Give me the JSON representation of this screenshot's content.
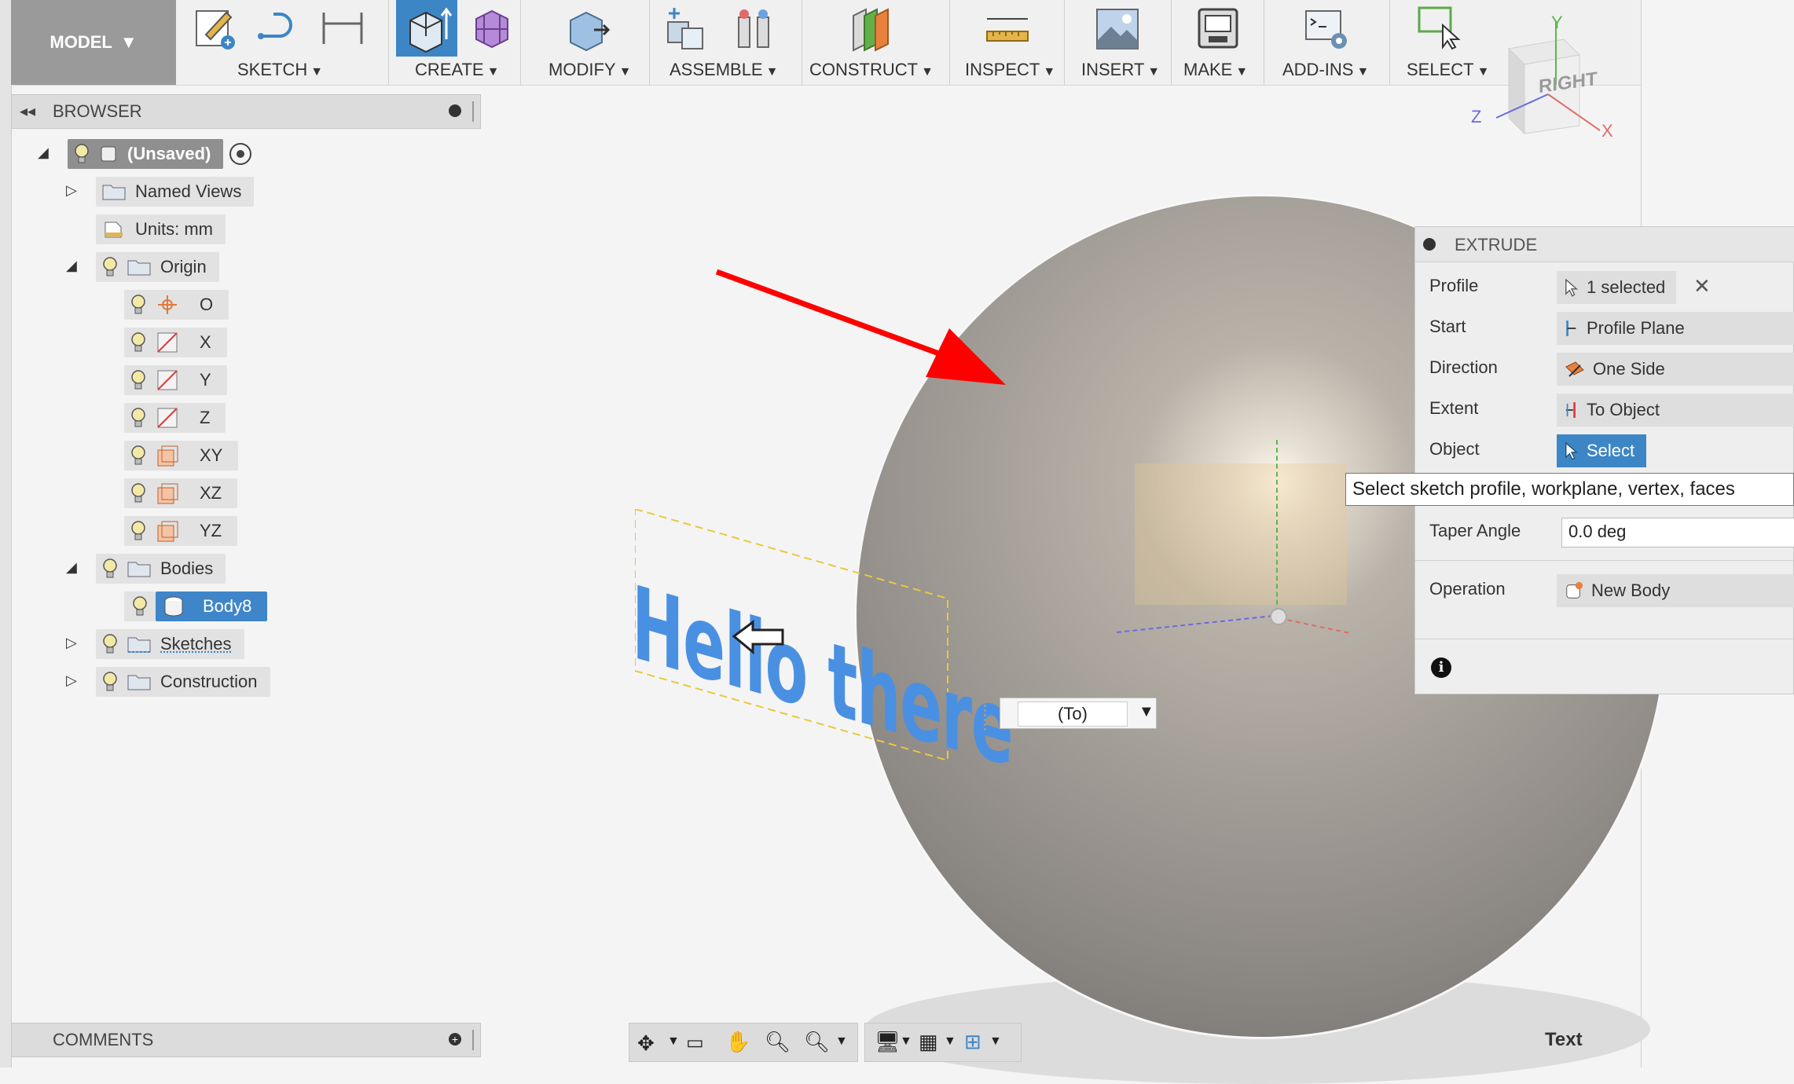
{
  "toolbar": {
    "workspace_label": "MODEL",
    "groups": [
      {
        "label": "SKETCH"
      },
      {
        "label": "CREATE"
      },
      {
        "label": "MODIFY"
      },
      {
        "label": "ASSEMBLE"
      },
      {
        "label": "CONSTRUCT"
      },
      {
        "label": "INSPECT"
      },
      {
        "label": "INSERT"
      },
      {
        "label": "MAKE"
      },
      {
        "label": "ADD-INS"
      },
      {
        "label": "SELECT"
      }
    ]
  },
  "view_cube": {
    "face_label": "RIGHT",
    "axis_y": "Y",
    "axis_z": "Z",
    "axis_x": "X"
  },
  "browser": {
    "title": "BROWSER",
    "tree": {
      "root": "(Unsaved)",
      "named_views": "Named Views",
      "units": "Units: mm",
      "origin": "Origin",
      "origin_items": [
        "O",
        "X",
        "Y",
        "Z",
        "XY",
        "XZ",
        "YZ"
      ],
      "bodies": "Bodies",
      "body_item": "Body8",
      "sketches": "Sketches",
      "construction": "Construction"
    }
  },
  "comments": {
    "title": "COMMENTS"
  },
  "canvas": {
    "sketch_text": "Hello there",
    "extent_dropdown_value": "(To)",
    "corner_label": "Text"
  },
  "extrude_panel": {
    "title": "EXTRUDE",
    "rows": {
      "profile_label": "Profile",
      "profile_value": "1 selected",
      "start_label": "Start",
      "start_value": "Profile Plane",
      "direction_label": "Direction",
      "direction_value": "One Side",
      "extent_label": "Extent",
      "extent_value": "To Object",
      "object_label": "Object",
      "object_value": "Select",
      "taper_label": "Taper Angle",
      "taper_value": "0.0 deg",
      "operation_label": "Operation",
      "operation_value": "New Body"
    },
    "tooltip": "Select sketch profile, workplane, vertex, faces"
  },
  "colors": {
    "accent_blue": "#3d86c6",
    "annotation_red": "#ff0000",
    "sketch_text_blue": "#4a90e2"
  }
}
